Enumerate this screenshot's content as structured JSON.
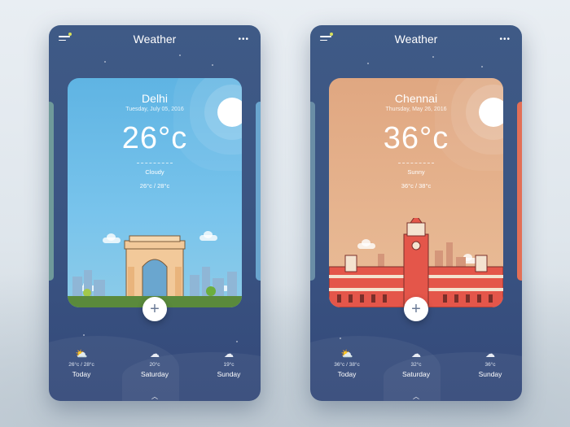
{
  "screens": [
    {
      "title": "Weather",
      "city": "Delhi",
      "date": "Tuesday, July 05, 2016",
      "temperature": "26°c",
      "condition": "Cloudy",
      "range": "26°c / 28°c",
      "forecast": [
        {
          "icon": "partly-cloudy-icon",
          "range": "26°c / 28°c",
          "day": "Today"
        },
        {
          "icon": "snow-cloud-icon",
          "range": "20°c",
          "day": "Saturday"
        },
        {
          "icon": "snow-cloud-icon",
          "range": "19°c",
          "day": "Sunday"
        }
      ]
    },
    {
      "title": "Weather",
      "city": "Chennai",
      "date": "Thursday, May 26, 2016",
      "temperature": "36°c",
      "condition": "Sunny",
      "range": "36°c / 38°c",
      "forecast": [
        {
          "icon": "partly-cloudy-icon",
          "range": "36°c / 38°c",
          "day": "Today"
        },
        {
          "icon": "snow-cloud-icon",
          "range": "32°c",
          "day": "Saturday"
        },
        {
          "icon": "snow-cloud-icon",
          "range": "36°c",
          "day": "Sunday"
        }
      ]
    }
  ],
  "colors": {
    "phone_bg": "#3c5684",
    "delhi_sky": "#6dbde8",
    "chennai_sky": "#e3ad87",
    "accent_dot": "#d8e05a"
  }
}
